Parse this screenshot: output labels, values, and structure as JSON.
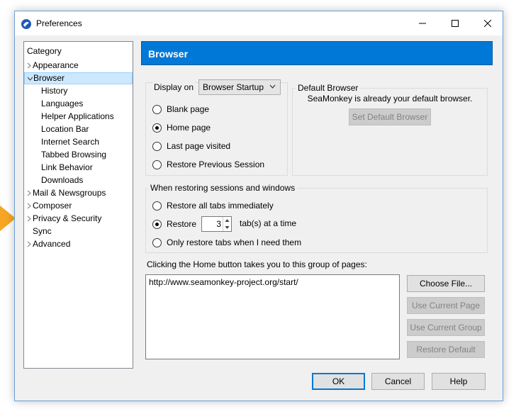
{
  "window": {
    "title": "Preferences"
  },
  "sidebar": {
    "header": "Category",
    "items": [
      {
        "label": "Appearance",
        "twisty": "collapsed"
      },
      {
        "label": "Browser",
        "twisty": "expanded",
        "selected": true
      },
      {
        "label": "History"
      },
      {
        "label": "Languages"
      },
      {
        "label": "Helper Applications"
      },
      {
        "label": "Location Bar"
      },
      {
        "label": "Internet Search"
      },
      {
        "label": "Tabbed Browsing"
      },
      {
        "label": "Link Behavior"
      },
      {
        "label": "Downloads"
      },
      {
        "label": "Mail & Newsgroups",
        "twisty": "collapsed"
      },
      {
        "label": "Composer",
        "twisty": "collapsed"
      },
      {
        "label": "Privacy & Security",
        "twisty": "collapsed"
      },
      {
        "label": "Sync"
      },
      {
        "label": "Advanced",
        "twisty": "collapsed"
      }
    ]
  },
  "panel": {
    "title": "Browser",
    "display_on": {
      "label": "Display on",
      "selected": "Browser Startup",
      "options": [
        {
          "label": "Blank page",
          "checked": false
        },
        {
          "label": "Home page",
          "checked": true
        },
        {
          "label": "Last page visited",
          "checked": false
        },
        {
          "label": "Restore Previous Session",
          "checked": false
        }
      ]
    },
    "default_browser": {
      "legend": "Default Browser",
      "status": "SeaMonkey is already your default browser.",
      "button": "Set Default Browser"
    },
    "restore": {
      "legend": "When restoring sessions and windows",
      "opt_all": "Restore all tabs immediately",
      "opt_restore": "Restore",
      "count": "3",
      "suffix": "tab(s) at a time",
      "opt_only": "Only restore tabs when I need them"
    },
    "home": {
      "label": "Clicking the Home button takes you to this group of pages:",
      "url": "http://www.seamonkey-project.org/start/",
      "choose_file": "Choose File...",
      "use_current_page": "Use Current Page",
      "use_current_group": "Use Current Group",
      "restore_default": "Restore Default"
    }
  },
  "footer": {
    "ok": "OK",
    "cancel": "Cancel",
    "help": "Help"
  },
  "colors": {
    "accent": "#0078d7",
    "selection": "#cce8ff",
    "pointer": "#f5a623"
  }
}
